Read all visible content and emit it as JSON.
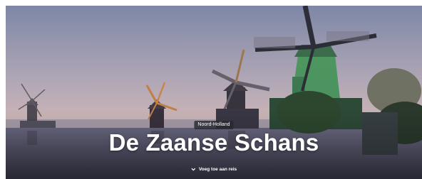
{
  "hero": {
    "region_badge": "Noord-Holland",
    "title": "De Zaanse Schans",
    "add_to_trip_label": "Voeg toe aan reis",
    "add_to_trip_icon": "chevron-down-icon",
    "photo_subject": "windmills-along-river"
  },
  "colors": {
    "sky_top": "#7f8aa8",
    "sky_bottom": "#e9cfc6",
    "water": "#4e4f63",
    "mill_green": "#4f9a63",
    "text": "#ffffff"
  }
}
